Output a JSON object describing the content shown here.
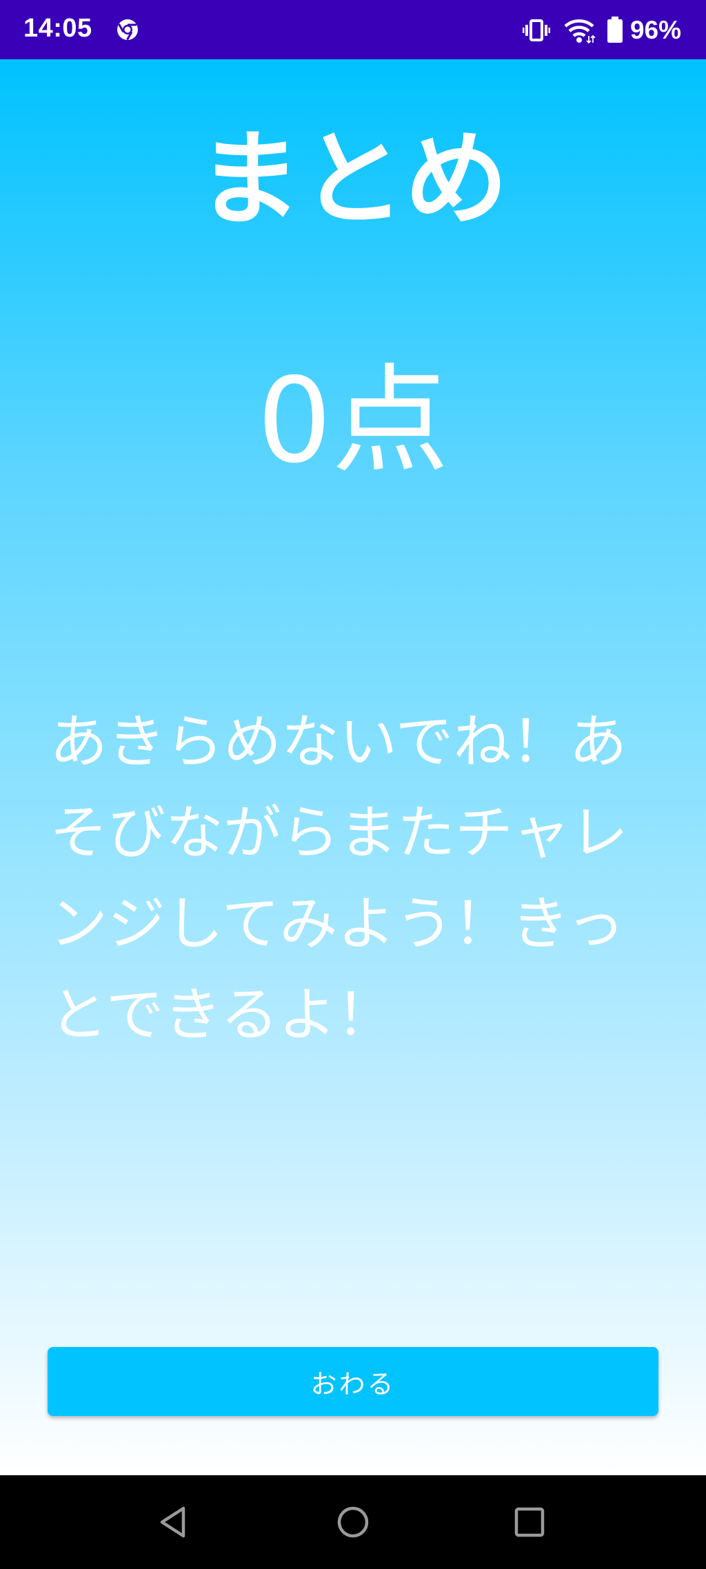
{
  "status_bar": {
    "time": "14:05",
    "battery_percent": "96%",
    "icons": [
      "chrome-icon",
      "vibrate-icon",
      "wifi-icon",
      "battery-icon"
    ]
  },
  "summary": {
    "title": "まとめ",
    "score": "0点",
    "message": "あきらめないでね！あそびながらまたチャレンジしてみよう！きっとできるよ！"
  },
  "actions": {
    "finish_label": "おわる"
  },
  "nav_bar": {
    "icons": [
      "back-icon",
      "home-icon",
      "recents-icon"
    ]
  },
  "colors": {
    "status_bar": "#3a00b8",
    "gradient_top": "#00c2ff",
    "gradient_bottom": "#ffffff",
    "button": "#00c3ff",
    "text": "#ffffff"
  }
}
